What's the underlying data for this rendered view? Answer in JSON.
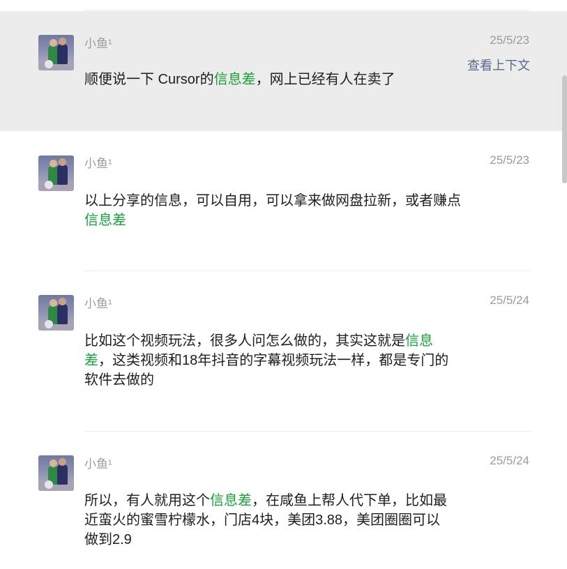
{
  "messages": [
    {
      "author": "小鱼¹",
      "date": "25/5/23",
      "context_link": "查看上下文",
      "content": [
        {
          "text": "顺便说一下 Cursor的"
        },
        {
          "text": "信息差",
          "highlight": true
        },
        {
          "text": "，网上已经有人在卖了"
        }
      ]
    },
    {
      "author": "小鱼¹",
      "date": "25/5/23",
      "content": [
        {
          "text": "以上分享的信息，可以自用，可以拿来做网盘拉新，或者赚点"
        },
        {
          "text": "信息差",
          "highlight": true
        }
      ]
    },
    {
      "author": "小鱼¹",
      "date": "25/5/24",
      "content": [
        {
          "text": "比如这个视频玩法，很多人问怎么做的，其实这就是"
        },
        {
          "text": "信息差",
          "highlight": true
        },
        {
          "text": "，这类视频和18年抖音的字幕视频玩法一样，都是专门的软件去做的"
        }
      ]
    },
    {
      "author": "小鱼¹",
      "date": "25/5/24",
      "content": [
        {
          "text": "所以，有人就用这个"
        },
        {
          "text": "信息差",
          "highlight": true
        },
        {
          "text": "，在咸鱼上帮人代下单，比如最近蛮火的蜜雪柠檬水，门店4块，美团3.88，美团圈圈可以做到2.9"
        }
      ]
    }
  ],
  "colors": {
    "highlight_text": "#1aa33a",
    "selected_row_bg": "#ececec",
    "meta_text": "#9b9b9b",
    "link_text": "#5a6a8a"
  },
  "icons": {
    "avatar": "avatar-photo-icon"
  }
}
